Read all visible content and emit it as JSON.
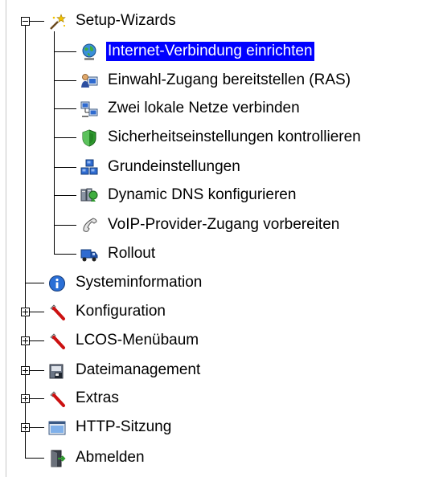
{
  "tree": {
    "setup_wizards": {
      "label": "Setup-Wizards",
      "icon": "magic-wand-icon",
      "children": [
        {
          "label": "Internet-Verbindung einrichten",
          "icon": "globe-icon",
          "selected": true
        },
        {
          "label": "Einwahl-Zugang bereitstellen (RAS)",
          "icon": "remote-user-icon"
        },
        {
          "label": "Zwei lokale Netze verbinden",
          "icon": "two-computers-icon"
        },
        {
          "label": "Sicherheitseinstellungen kontrollieren",
          "icon": "shield-icon"
        },
        {
          "label": "Grundeinstellungen",
          "icon": "network-blocks-icon"
        },
        {
          "label": "Dynamic DNS konfigurieren",
          "icon": "dns-servers-icon"
        },
        {
          "label": "VoIP-Provider-Zugang vorbereiten",
          "icon": "phone-handset-icon"
        },
        {
          "label": "Rollout",
          "icon": "truck-icon"
        }
      ]
    },
    "top_items": [
      {
        "label": "Systeminformation",
        "icon": "info-icon"
      },
      {
        "label": "Konfiguration",
        "icon": "wrench-icon"
      },
      {
        "label": "LCOS-Menübaum",
        "icon": "wrench-icon"
      },
      {
        "label": "Dateimanagement",
        "icon": "file-cabinet-icon"
      },
      {
        "label": "Extras",
        "icon": "wrench-icon"
      },
      {
        "label": "HTTP-Sitzung",
        "icon": "browser-window-icon"
      },
      {
        "label": "Abmelden",
        "icon": "logout-door-icon"
      }
    ],
    "colors": {
      "selection_bg": "#0000ff",
      "selection_text": "#ffffff",
      "wrench_red": "#cc1111",
      "info_blue": "#2a6fd6"
    }
  }
}
